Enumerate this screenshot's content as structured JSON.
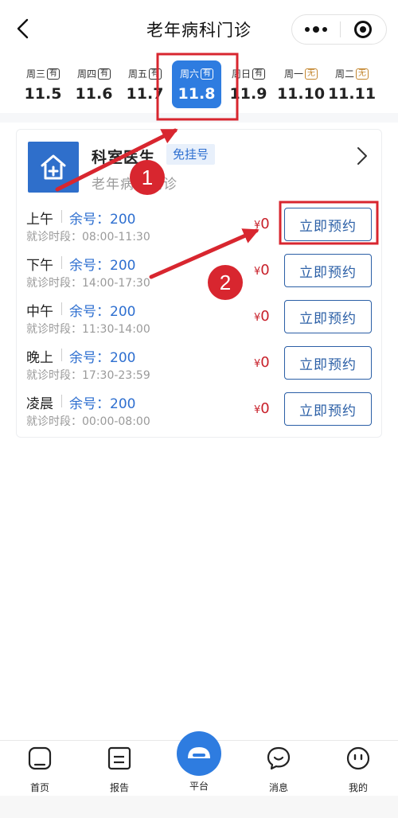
{
  "header": {
    "title": "老年病科门诊"
  },
  "dates": [
    {
      "weekday": "周三",
      "tag": "有",
      "date": "11.5",
      "active": false,
      "available": true
    },
    {
      "weekday": "周四",
      "tag": "有",
      "date": "11.6",
      "active": false,
      "available": true
    },
    {
      "weekday": "周五",
      "tag": "有",
      "date": "11.7",
      "active": false,
      "available": true
    },
    {
      "weekday": "周六",
      "tag": "有",
      "date": "11.8",
      "active": true,
      "available": true
    },
    {
      "weekday": "周日",
      "tag": "有",
      "date": "11.9",
      "active": false,
      "available": true
    },
    {
      "weekday": "周一",
      "tag": "无",
      "date": "11.10",
      "active": false,
      "available": false
    },
    {
      "weekday": "周二",
      "tag": "无",
      "date": "11.11",
      "active": false,
      "available": false
    }
  ],
  "department": {
    "name": "科室医生",
    "free_tag": "免挂号",
    "subtitle": "老年病科门诊"
  },
  "slots": [
    {
      "period": "上午",
      "remaining": "余号：200",
      "time": "就诊时段：08:00-11:30",
      "currency": "¥",
      "price": "0",
      "button": "立即预约"
    },
    {
      "period": "下午",
      "remaining": "余号：200",
      "time": "就诊时段：14:00-17:30",
      "currency": "¥",
      "price": "0",
      "button": "立即预约"
    },
    {
      "period": "中午",
      "remaining": "余号：200",
      "time": "就诊时段：11:30-14:00",
      "currency": "¥",
      "price": "0",
      "button": "立即预约"
    },
    {
      "period": "晚上",
      "remaining": "余号：200",
      "time": "就诊时段：17:30-23:59",
      "currency": "¥",
      "price": "0",
      "button": "立即预约"
    },
    {
      "period": "凌晨",
      "remaining": "余号：200",
      "time": "就诊时段：00:00-08:00",
      "currency": "¥",
      "price": "0",
      "button": "立即预约"
    }
  ],
  "annotations": {
    "step1": "1",
    "step2": "2"
  },
  "tabbar": [
    {
      "label": "首页",
      "icon": "home-icon"
    },
    {
      "label": "报告",
      "icon": "report-icon"
    },
    {
      "label": "平台",
      "icon": "platform-icon"
    },
    {
      "label": "消息",
      "icon": "message-icon"
    },
    {
      "label": "我的",
      "icon": "profile-icon"
    }
  ],
  "colors": {
    "accent": "#2e7ce0",
    "annotation": "#d8262f",
    "price": "#c8202a",
    "button_border": "#2b5fa6",
    "unavailable_tag": "#c4862e"
  }
}
